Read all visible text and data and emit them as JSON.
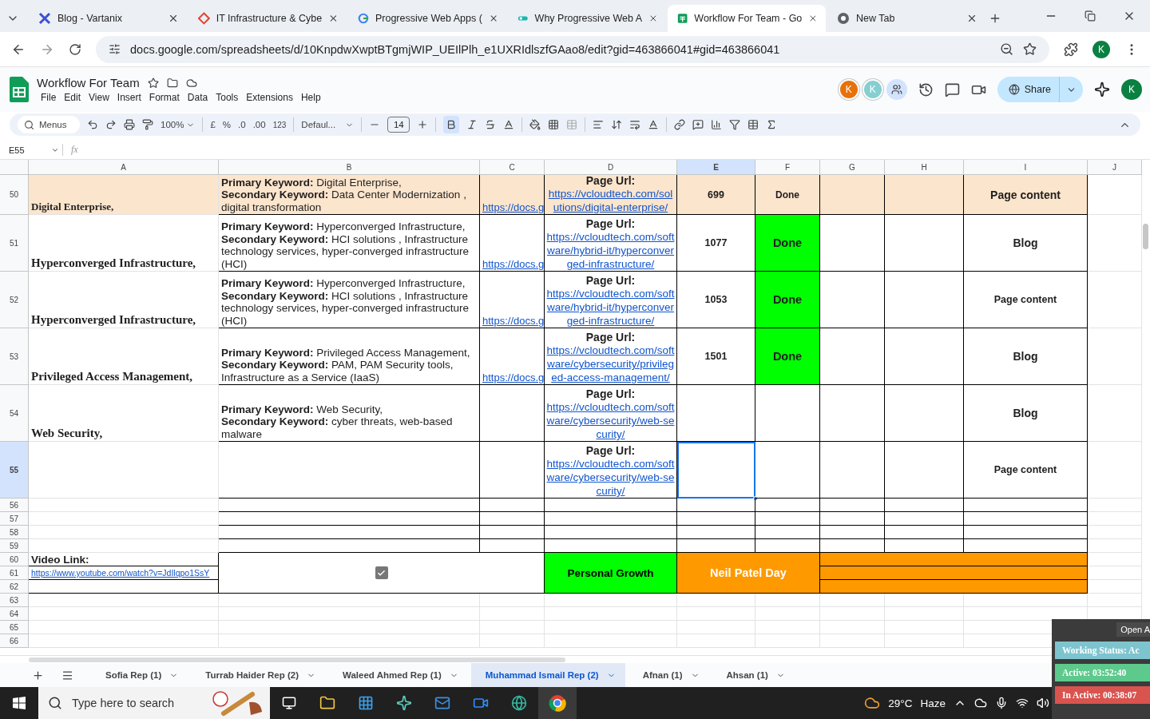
{
  "browser": {
    "tabs": [
      {
        "title": "Blog - Vartanix",
        "selected": false
      },
      {
        "title": "IT Infrastructure & Cybe",
        "selected": false
      },
      {
        "title": "Progressive Web Apps (",
        "selected": false
      },
      {
        "title": "Why Progressive Web A",
        "selected": false
      },
      {
        "title": "Workflow For Team - Go",
        "selected": true
      },
      {
        "title": "New Tab",
        "selected": false
      }
    ],
    "url": "docs.google.com/spreadsheets/d/10KnpdwXwptBTgmjWIP_UEIlPlh_e1UXRIdlszfGAao8/edit?gid=463866041#gid=463866041",
    "profile": "K"
  },
  "doc": {
    "title": "Workflow For Team",
    "menu": [
      "File",
      "Edit",
      "View",
      "Insert",
      "Format",
      "Data",
      "Tools",
      "Extensions",
      "Help"
    ],
    "collaborators": [
      {
        "initial": "K",
        "color": "#e8710a"
      },
      {
        "initial": "K",
        "color": "#86cfd0"
      }
    ],
    "share": "Share",
    "profile": "K"
  },
  "toolbar": {
    "search": "Menus",
    "zoom": "100%",
    "currency": "£",
    "percent": "%",
    "decimal_less": ".0",
    "decimal_more": ".00",
    "format": "123",
    "font": "Defaul...",
    "font_size": "14",
    "bold_on": true
  },
  "formula_bar": {
    "cell": "E55",
    "fx": "fx"
  },
  "grid": {
    "columns": [
      {
        "label": "A",
        "selected": false
      },
      {
        "label": "B",
        "selected": false
      },
      {
        "label": "C",
        "selected": false
      },
      {
        "label": "D",
        "selected": false
      },
      {
        "label": "E",
        "selected": true
      },
      {
        "label": "F",
        "selected": false
      },
      {
        "label": "G",
        "selected": false
      },
      {
        "label": "H",
        "selected": false
      },
      {
        "label": "I",
        "selected": false
      },
      {
        "label": "J",
        "selected": false
      }
    ],
    "row_numbers": [
      {
        "label": "50",
        "selected": false
      },
      {
        "label": "51",
        "selected": false
      },
      {
        "label": "52",
        "selected": false
      },
      {
        "label": "53",
        "selected": false
      },
      {
        "label": "54",
        "selected": false
      },
      {
        "label": "55",
        "selected": true
      },
      {
        "label": "56",
        "selected": false
      },
      {
        "label": "57",
        "selected": false
      },
      {
        "label": "58",
        "selected": false
      },
      {
        "label": "59",
        "selected": false
      },
      {
        "label": "60",
        "selected": false
      },
      {
        "label": "61",
        "selected": false
      },
      {
        "label": "62",
        "selected": false
      },
      {
        "label": "63",
        "selected": false
      },
      {
        "label": "64",
        "selected": false
      },
      {
        "label": "65",
        "selected": false
      },
      {
        "label": "66",
        "selected": false
      }
    ],
    "rows": [
      {
        "highlighted": true,
        "selected": false,
        "topic": "Digital Enterprise,",
        "keywords": "**Primary Keyword:** Digital Enterprise,\n**Secondary Keyword:** Data Center Modernization , digital transformation",
        "doc_link": "https://docs.g",
        "page_label": "Page Url:",
        "page_url": "https://vcloudtech.com/solutions/digital-enterprise/",
        "words": "699",
        "status": {
          "label": "Done"
        },
        "content_type": "Page content"
      },
      {
        "highlighted": false,
        "selected": false,
        "topic": "Hyperconverged Infrastructure,",
        "keywords": "**Primary Keyword:** Hyperconverged Infrastructure,\n**Secondary Keyword:** HCI solutions , Infrastructure technology services, hyper-converged infrastructure (HCI)",
        "doc_link": "https://docs.g",
        "page_label": "Page Url:",
        "page_url": "https://vcloudtech.com/software/hybrid-it/hyperconverged-infrastructure/",
        "words": "1077",
        "status": {
          "label": "Done",
          "color": "#00ff00"
        },
        "content_type": "Blog"
      },
      {
        "highlighted": false,
        "selected": false,
        "topic": "Hyperconverged Infrastructure,",
        "keywords": "**Primary Keyword:** Hyperconverged Infrastructure,\n**Secondary Keyword:** HCI solutions , Infrastructure technology services, hyper-converged infrastructure (HCI)",
        "doc_link": "https://docs.g",
        "page_label": "Page Url:",
        "page_url": "https://vcloudtech.com/software/hybrid-it/hyperconverged-infrastructure/",
        "words": "1053",
        "status": {
          "label": "Done",
          "color": "#00ff00"
        },
        "content_type": "Page content"
      },
      {
        "highlighted": false,
        "selected": false,
        "topic": "Privileged Access Management,",
        "keywords": "**Primary Keyword:** Privileged Access Management,\n**Secondary Keyword:** PAM, PAM Security tools, Infrastructure as a Service (IaaS)",
        "doc_link": "https://docs.g",
        "page_label": "Page Url:",
        "page_url": "https://vcloudtech.com/software/cybersecurity/privileged-access-management/",
        "words": "1501",
        "status": {
          "label": "Done",
          "color": "#00ff00"
        },
        "content_type": "Blog"
      },
      {
        "highlighted": false,
        "selected": false,
        "topic": "Web Security,",
        "keywords": "**Primary Keyword:** Web Security,\n**Secondary Keyword:** cyber threats, web-based malware",
        "page_label": "Page Url:",
        "page_url": "https://vcloudtech.com/software/cybersecurity/web-security/",
        "content_type": "Blog"
      },
      {
        "highlighted": false,
        "selected": true,
        "page_label": "Page Url:",
        "page_url": "https://vcloudtech.com/software/cybersecurity/web-security/",
        "content_type": "Page content"
      }
    ],
    "footer_block": {
      "video_label": "Video Link:",
      "video_url": "https://www.youtube.com/watch?v=JdIlqpo1SsY",
      "checked": true,
      "tags": [
        {
          "label": "Personal Growth",
          "color": "#00ff00"
        },
        {
          "label": "Neil Patel Day",
          "color": "#ff9900"
        }
      ]
    }
  },
  "sheet_tabs": [
    {
      "label": "Sofia Rep (1)",
      "selected": false
    },
    {
      "label": "Turrab Haider Rep (2)",
      "selected": false
    },
    {
      "label": "Waleed Ahmed Rep (1)",
      "selected": false
    },
    {
      "label": "Muhammad Ismail Rep (2)",
      "selected": true
    },
    {
      "label": "Afnan (1)",
      "selected": false
    },
    {
      "label": "Ahsan (1)",
      "selected": false
    }
  ],
  "taskbar": {
    "search_placeholder": "Type here to search",
    "temperature": "29°C",
    "weather": "Haze"
  },
  "tracker": {
    "open": "Open A",
    "status": "Working Status: Ac",
    "active": "Active: 03:52:40",
    "inactive": "In Active: 00:38:07"
  }
}
